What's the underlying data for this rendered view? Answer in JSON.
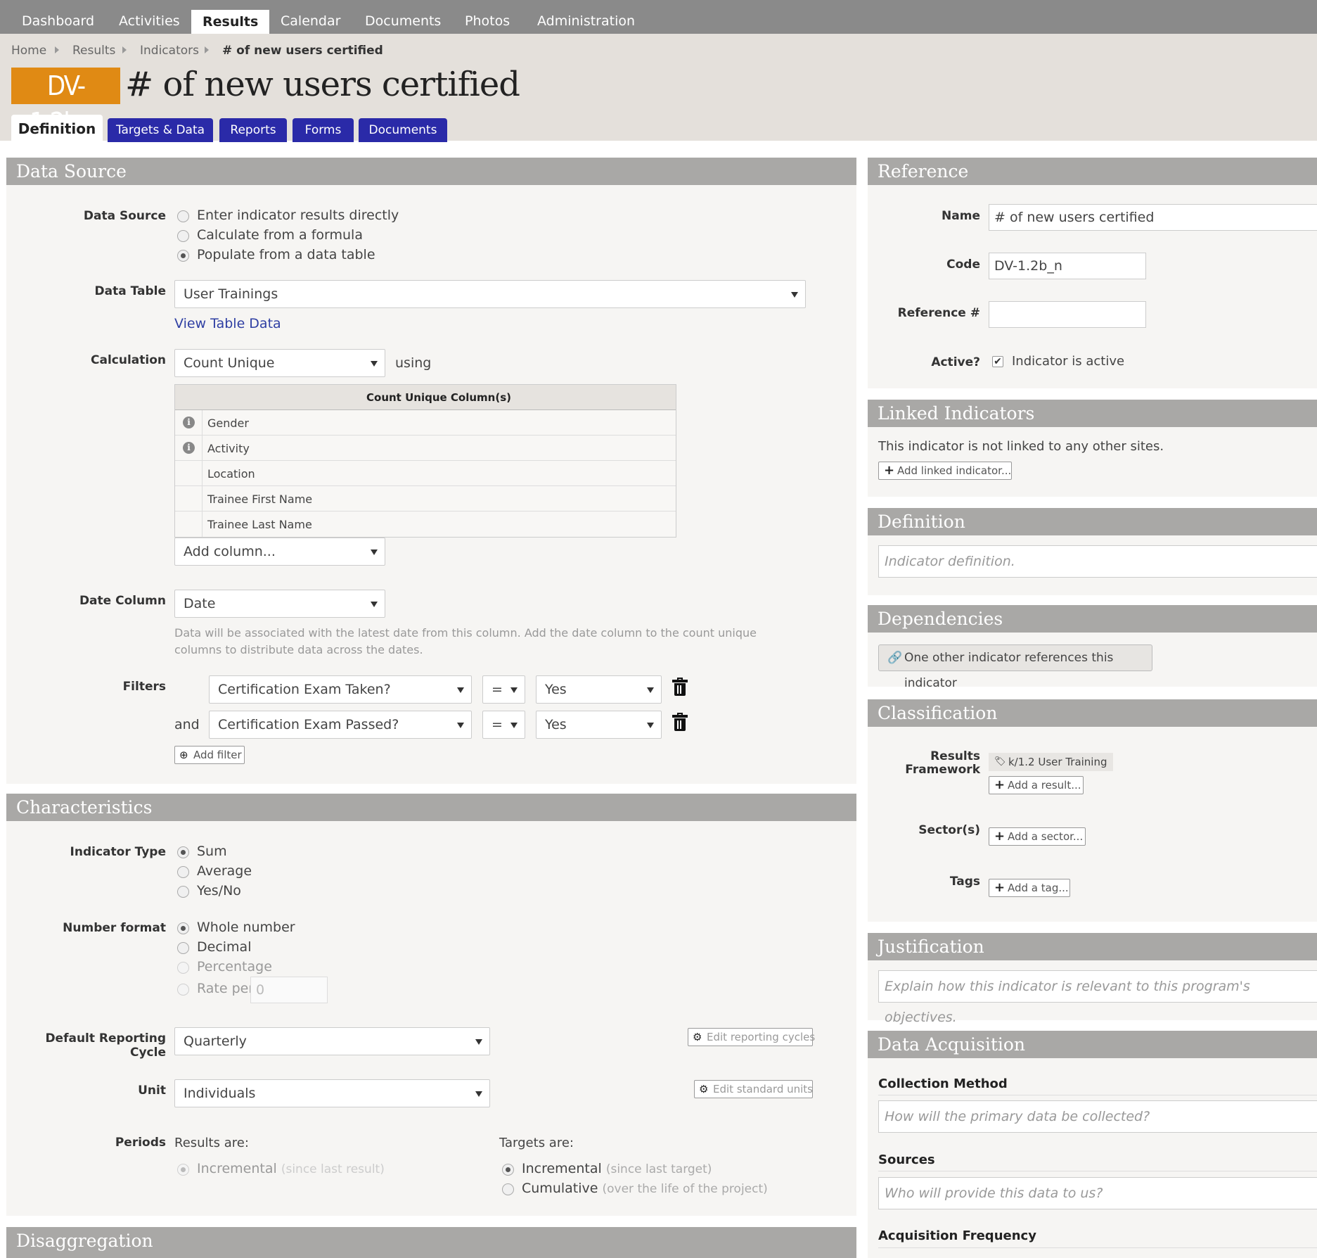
{
  "topnav": {
    "items": [
      "Dashboard",
      "Activities",
      "Results",
      "Calendar",
      "Documents",
      "Photos",
      "Administration"
    ],
    "active": "Results"
  },
  "breadcrumb": [
    "Home",
    "Results",
    "Indicators",
    "# of new users certified"
  ],
  "indicator": {
    "code": "DV-1.2b_n",
    "title": "# of new users certified"
  },
  "tabs": [
    "Definition",
    "Targets & Data",
    "Reports",
    "Forms",
    "Documents"
  ],
  "data_source": {
    "heading": "Data Source",
    "label": "Data Source",
    "options": [
      "Enter indicator results directly",
      "Calculate from a formula",
      "Populate from a data table"
    ],
    "selected": "Populate from a data table",
    "data_table_label": "Data Table",
    "data_table_value": "User Trainings",
    "view_table_link": "View Table Data",
    "calculation_label": "Calculation",
    "calculation_value": "Count Unique",
    "using_text": "using",
    "grid_header": "Count Unique Column(s)",
    "columns": [
      "Gender",
      "Activity",
      "Location",
      "Trainee First Name",
      "Trainee Last Name"
    ],
    "add_column_placeholder": "Add column...",
    "date_column_label": "Date Column",
    "date_column_value": "Date",
    "date_help": "Data will be associated with the latest date from this column. Add the date column to the count unique columns to distribute data across the dates.",
    "filters_label": "Filters",
    "and_text": "and",
    "filters": [
      {
        "field": "Certification Exam Taken?",
        "op": "=",
        "value": "Yes"
      },
      {
        "field": "Certification Exam Passed?",
        "op": "=",
        "value": "Yes"
      }
    ],
    "add_filter": "Add filter"
  },
  "characteristics": {
    "heading": "Characteristics",
    "indicator_type_label": "Indicator Type",
    "indicator_type_options": [
      "Sum",
      "Average",
      "Yes/No"
    ],
    "indicator_type_selected": "Sum",
    "number_format_label": "Number format",
    "number_format_options": [
      "Whole number",
      "Decimal",
      "Percentage",
      "Rate per"
    ],
    "number_format_selected": "Whole number",
    "rate_per_value": "0",
    "reporting_cycle_label": "Default Reporting Cycle",
    "reporting_cycle_value": "Quarterly",
    "edit_reporting_cycles": "Edit reporting cycles",
    "unit_label": "Unit",
    "unit_value": "Individuals",
    "edit_standard_units": "Edit standard units",
    "periods_label": "Periods",
    "results_are": "Results are:",
    "results_incremental": "Incremental",
    "results_incremental_note": "(since last result)",
    "targets_are": "Targets are:",
    "targets_incremental": "Incremental",
    "targets_incremental_note": "(since last target)",
    "targets_cumulative": "Cumulative",
    "targets_cumulative_note": "(over the life of the project)",
    "targets_selected": "Incremental"
  },
  "disaggregation": {
    "heading": "Disaggregation"
  },
  "reference": {
    "heading": "Reference",
    "name_label": "Name",
    "name_value": "# of new users certified",
    "code_label": "Code",
    "code_value": "DV-1.2b_n",
    "ref_label": "Reference #",
    "ref_value": "",
    "active_label": "Active?",
    "active_text": "Indicator is active",
    "active_checked": true
  },
  "linked": {
    "heading": "Linked Indicators",
    "text": "This indicator is not linked to any other sites.",
    "add_button": "Add linked indicator..."
  },
  "definition": {
    "heading": "Definition",
    "placeholder": "Indicator definition."
  },
  "dependencies": {
    "heading": "Dependencies",
    "button": "One other indicator references this indicator"
  },
  "classification": {
    "heading": "Classification",
    "framework_label_1": "Results",
    "framework_label_2": "Framework",
    "framework_tag": "k/1.2 User Training",
    "add_result": "Add a result...",
    "sectors_label": "Sector(s)",
    "add_sector": "Add a sector...",
    "tags_label": "Tags",
    "add_tag": "Add a tag..."
  },
  "justification": {
    "heading": "Justification",
    "placeholder": "Explain how this indicator is relevant to this program's objectives."
  },
  "acquisition": {
    "heading": "Data Acquisition",
    "collection_label": "Collection Method",
    "collection_placeholder": "How will the primary data be collected?",
    "sources_label": "Sources",
    "sources_placeholder": "Who will provide this data to us?",
    "frequency_label": "Acquisition Frequency"
  },
  "colors": {
    "nav_bg": "#8a8a8a",
    "header_bg": "#e4e0db",
    "badge": "#e08a14",
    "tab": "#2a2aa8",
    "panel_head": "#a9a8a6",
    "link": "#2f3fa3"
  }
}
